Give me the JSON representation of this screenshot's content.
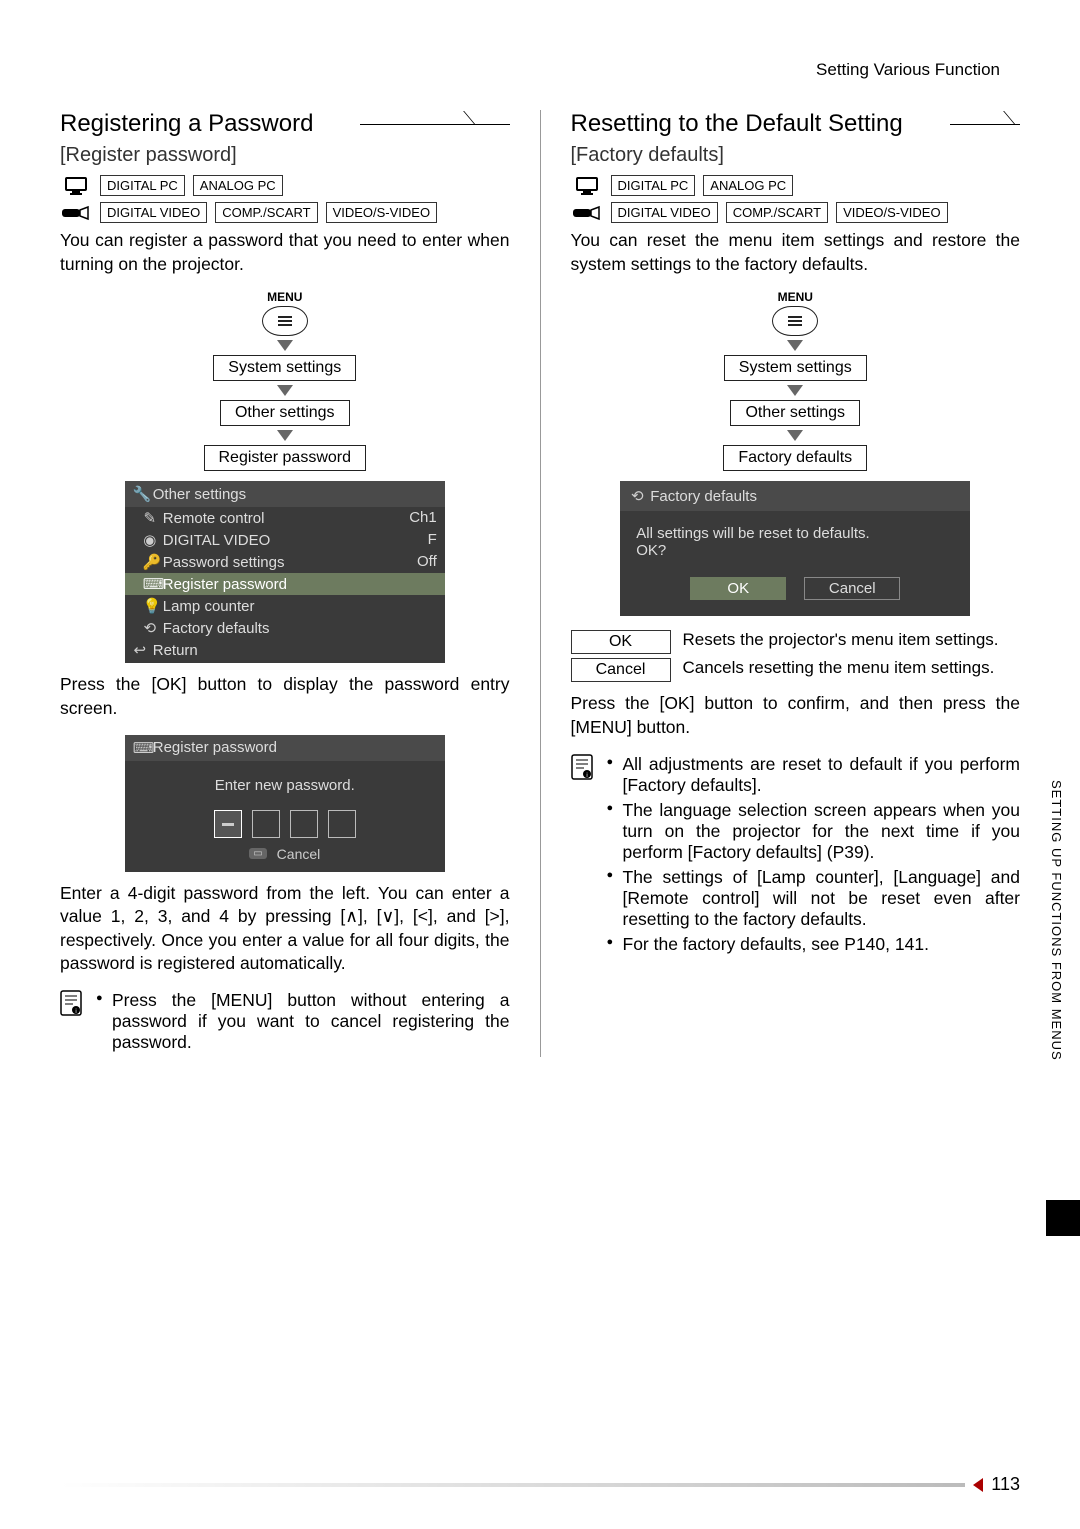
{
  "header": {
    "breadcrumb": "Setting Various Function"
  },
  "side": {
    "label": "SETTING UP FUNCTIONS FROM MENUS"
  },
  "page_number": "113",
  "input_tags": {
    "dpc": "DIGITAL PC",
    "apc": "ANALOG PC",
    "dv": "DIGITAL VIDEO",
    "cs": "COMP./SCART",
    "sv": "VIDEO/S-VIDEO"
  },
  "flow": {
    "menu": "MENU",
    "sys": "System settings",
    "other": "Other settings",
    "reg": "Register password",
    "fac": "Factory defaults"
  },
  "left": {
    "title": "Registering a Password",
    "subtitle": "[Register password]",
    "intro": "You can register a password that you need to enter when turning on the projector.",
    "osd1": {
      "header": "Other settings",
      "rows": {
        "r1l": "Remote control",
        "r1r": "Ch1",
        "r2l": "DIGITAL VIDEO",
        "r2r": "F",
        "r3l": "Password settings",
        "r3r": "Off",
        "r4l": "Register password",
        "r5l": "Lamp counter",
        "r6l": "Factory defaults"
      },
      "return": "Return"
    },
    "after_osd1": "Press the [OK] button to display the password entry screen.",
    "osd2": {
      "header": "Register password",
      "msg": "Enter new password.",
      "cancel": "Cancel"
    },
    "after_osd2": "Enter a 4-digit password from the left. You can enter a value 1, 2, 3, and 4 by pressing [∧], [∨], [<], and [>], respectively. Once you enter a value for all four digits, the password is registered automatically.",
    "note": "Press the [MENU] button without entering a password if you want to cancel registering the password."
  },
  "right": {
    "title": "Resetting to the Default Setting",
    "subtitle": "[Factory defaults]",
    "intro": "You can reset the menu item settings and restore the system settings to the factory defaults.",
    "osd3": {
      "header": "Factory defaults",
      "msg1": "All settings will be reset to defaults.",
      "msg2": "OK?",
      "ok": "OK",
      "cancel": "Cancel"
    },
    "opts": {
      "ok_l": "OK",
      "ok_v": "Resets the projector's menu item settings.",
      "c_l": "Cancel",
      "c_v": "Cancels resetting the menu item settings."
    },
    "after": "Press the [OK] button to confirm, and then press the [MENU] button.",
    "notes": {
      "n1": "All adjustments are reset to default if you perform [Factory defaults].",
      "n2": "The language selection screen appears when you turn on the projector for the next time if you perform [Factory defaults] (P39).",
      "n3": "The settings of [Lamp counter], [Language] and [Remote control] will not be reset even after resetting to the factory defaults.",
      "n4": "For the factory defaults, see P140, 141."
    }
  }
}
